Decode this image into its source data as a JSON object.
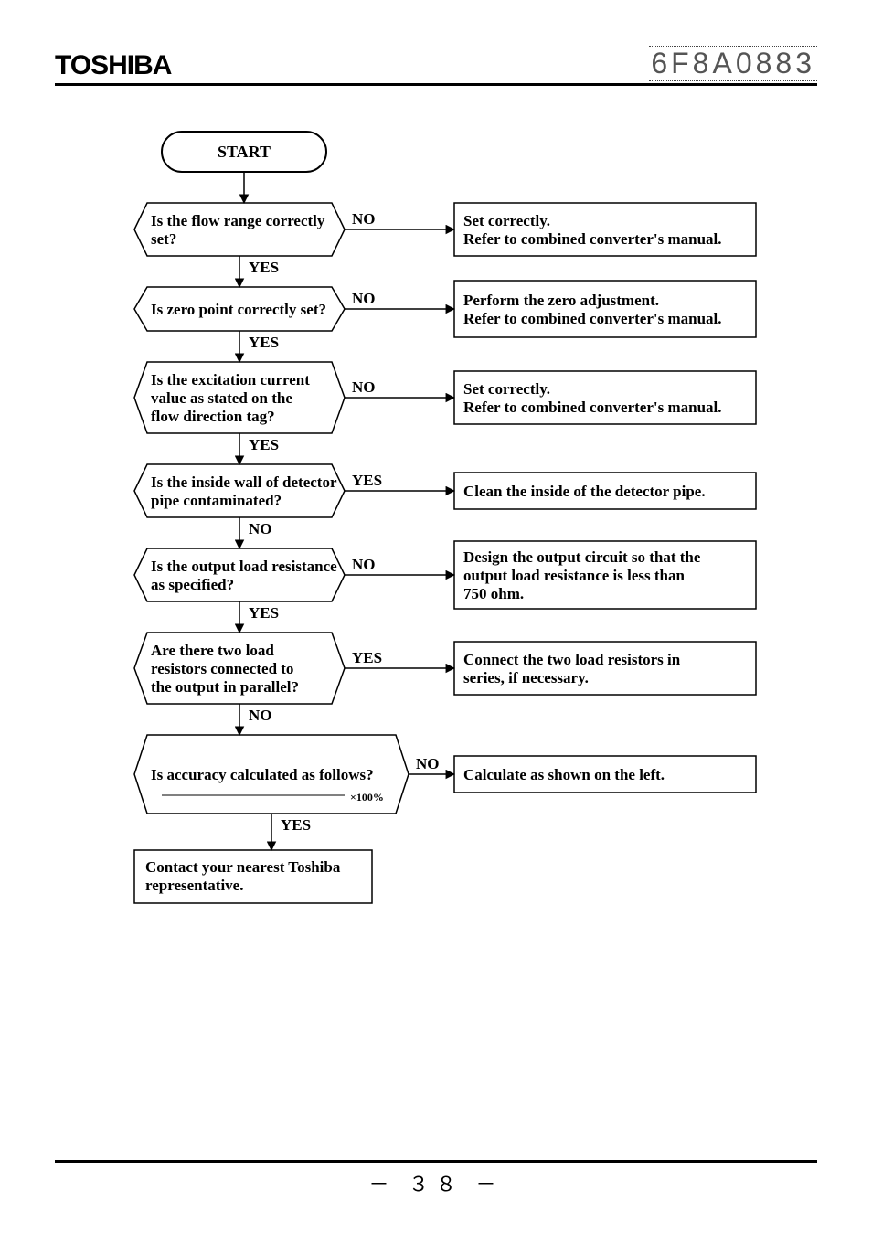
{
  "header": {
    "logo": "TOSHIBA",
    "docnum": "6F8A0883"
  },
  "footer": {
    "page": "３８"
  },
  "chart_data": {
    "type": "flowchart",
    "nodes": [
      {
        "id": "start",
        "shape": "terminator",
        "text": "START"
      },
      {
        "id": "d1",
        "shape": "decision",
        "text": [
          "Is the flow range correctly",
          "set?"
        ]
      },
      {
        "id": "p1",
        "shape": "process",
        "text": [
          "Set correctly.",
          "Refer to combined converter's manual."
        ]
      },
      {
        "id": "d2",
        "shape": "decision",
        "text": [
          "Is zero point correctly set?"
        ]
      },
      {
        "id": "p2",
        "shape": "process",
        "text": [
          "Perform the zero adjustment.",
          "Refer to combined converter's manual."
        ]
      },
      {
        "id": "d3",
        "shape": "decision",
        "text": [
          "Is the excitation current",
          "value as stated on the",
          "flow direction tag?"
        ]
      },
      {
        "id": "p3",
        "shape": "process",
        "text": [
          "Set correctly.",
          "Refer to combined converter's manual."
        ]
      },
      {
        "id": "d4",
        "shape": "decision",
        "text": [
          "Is the inside wall of detector",
          "pipe contaminated?"
        ]
      },
      {
        "id": "p4",
        "shape": "process",
        "text": [
          "Clean the inside of the detector pipe."
        ]
      },
      {
        "id": "d5",
        "shape": "decision",
        "text": [
          "Is the output load resistance",
          "as specified?"
        ]
      },
      {
        "id": "p5",
        "shape": "process",
        "text": [
          "Design the output circuit so that the",
          "output load resistance is less than",
          "750 ohm."
        ]
      },
      {
        "id": "d6",
        "shape": "decision",
        "text": [
          "Are there two load",
          "resistors connected to",
          "the output in parallel?"
        ]
      },
      {
        "id": "p6",
        "shape": "process",
        "text": [
          "Connect the two load resistors in",
          "series, if necessary."
        ]
      },
      {
        "id": "d7",
        "shape": "decision",
        "text": [
          "Is accuracy calculated as follows?"
        ],
        "formula": "×100%"
      },
      {
        "id": "p7",
        "shape": "process",
        "text": [
          "Calculate as shown on the left."
        ]
      },
      {
        "id": "end",
        "shape": "process",
        "text": [
          "Contact your nearest Toshiba",
          "representative."
        ]
      }
    ],
    "edges": [
      {
        "from": "start",
        "to": "d1"
      },
      {
        "from": "d1",
        "to": "p1",
        "label": "NO"
      },
      {
        "from": "d1",
        "to": "d2",
        "label": "YES"
      },
      {
        "from": "d2",
        "to": "p2",
        "label": "NO"
      },
      {
        "from": "d2",
        "to": "d3",
        "label": "YES"
      },
      {
        "from": "d3",
        "to": "p3",
        "label": "NO"
      },
      {
        "from": "d3",
        "to": "d4",
        "label": "YES"
      },
      {
        "from": "d4",
        "to": "p4",
        "label": "YES"
      },
      {
        "from": "d4",
        "to": "d5",
        "label": "NO"
      },
      {
        "from": "d5",
        "to": "p5",
        "label": "NO"
      },
      {
        "from": "d5",
        "to": "d6",
        "label": "YES"
      },
      {
        "from": "d6",
        "to": "p6",
        "label": "YES"
      },
      {
        "from": "d6",
        "to": "d7",
        "label": "NO"
      },
      {
        "from": "d7",
        "to": "p7",
        "label": "NO"
      },
      {
        "from": "d7",
        "to": "end",
        "label": "YES"
      }
    ],
    "labels": {
      "yes": "YES",
      "no": "NO"
    }
  }
}
